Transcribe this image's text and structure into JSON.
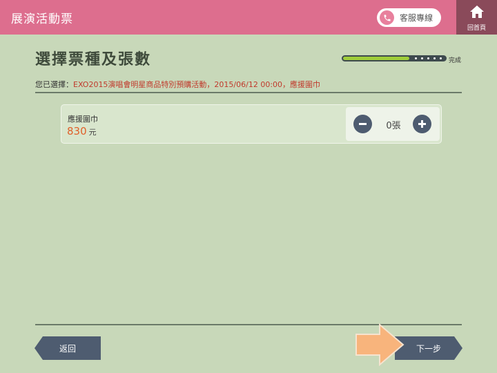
{
  "header": {
    "title": "展演活動票",
    "customer_service_label": "客服專線",
    "home_label": "回首頁"
  },
  "page": {
    "title": "選擇票種及張數",
    "progress": {
      "fraction": 0.64,
      "end_label": "完成"
    },
    "selection_label": "您已選擇：",
    "selection_value": "EXO2015演唱會明星商品特別預購活動，2015/06/12 00:00，應援圍巾"
  },
  "ticket": {
    "name": "應援圍巾",
    "price": "830",
    "unit": "元",
    "quantity": "0張"
  },
  "nav": {
    "back_label": "返回",
    "next_label": "下一步"
  },
  "colors": {
    "header": "#dd6e8e",
    "background": "#c8d8b9",
    "accent_price": "#e0602a",
    "selection_text": "#c0392b",
    "button": "#4e5c70",
    "progress_fill": "#9fcd3a"
  },
  "icons": [
    "phone-icon",
    "home-icon",
    "minus-icon",
    "plus-icon",
    "arrow-pointer-icon"
  ]
}
